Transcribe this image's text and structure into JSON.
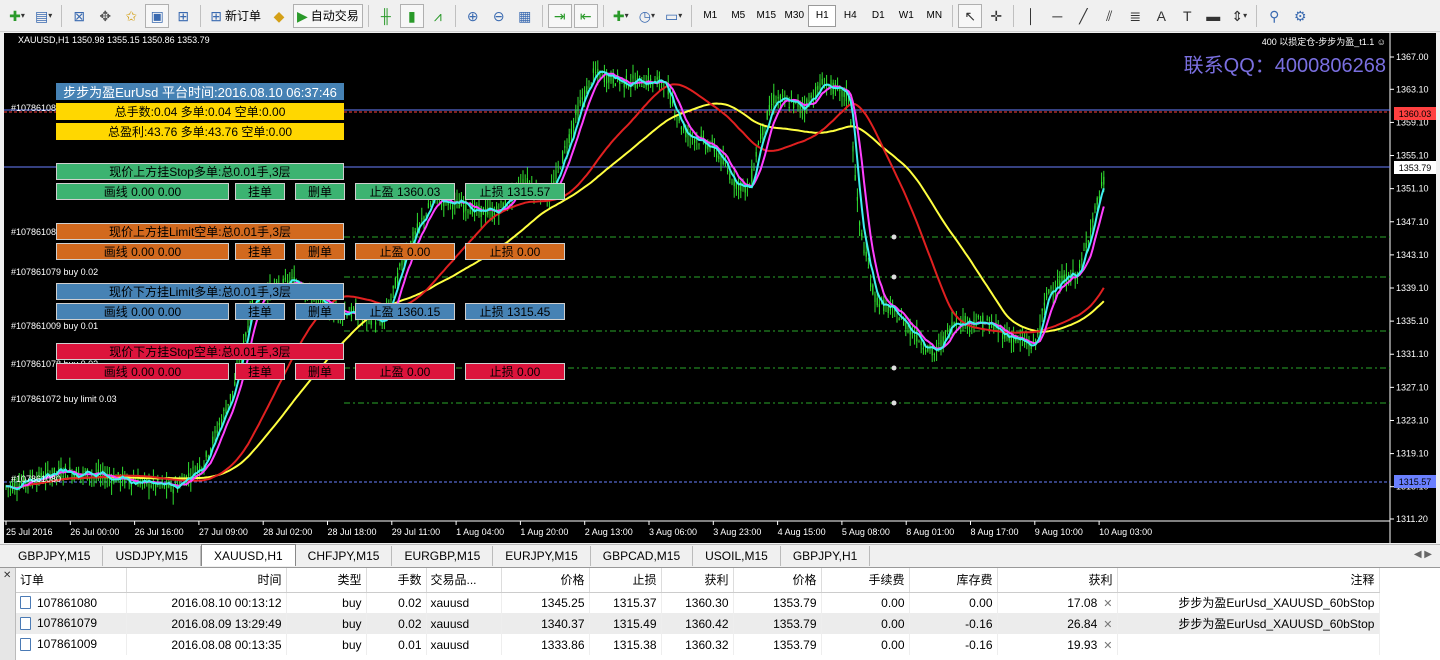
{
  "toolbar": {
    "new_order_label": "新订单",
    "auto_trading_label": "自动交易",
    "timeframes": [
      "M1",
      "M5",
      "M15",
      "M30",
      "H1",
      "H4",
      "D1",
      "W1",
      "MN"
    ],
    "active_timeframe": "H1"
  },
  "chart": {
    "title": "XAUUSD,H1  1350.98 1355.15 1350.86 1353.79",
    "top_right_label": "400 以损定仓-步步为盈_t1.1 ☺",
    "qq_label": "联系QQ：4000806268",
    "price_ticks": [
      "1367.00",
      "1363.10",
      "1359.10",
      "1355.10",
      "1351.10",
      "1347.10",
      "1343.10",
      "1339.10",
      "1335.10",
      "1331.10",
      "1327.10",
      "1323.10",
      "1319.10",
      "1315.10",
      "1311.20"
    ],
    "tags": {
      "tp": "1360.03",
      "current": "1353.79",
      "sl": "1315.57"
    },
    "time_labels": [
      "25 Jul 2016",
      "26 Jul 00:00",
      "26 Jul 16:00",
      "27 Jul 09:00",
      "28 Jul 02:00",
      "28 Jul 18:00",
      "29 Jul 11:00",
      "1 Aug 04:00",
      "1 Aug 20:00",
      "2 Aug 13:00",
      "3 Aug 06:00",
      "3 Aug 23:00",
      "4 Aug 15:00",
      "5 Aug 08:00",
      "8 Aug 01:00",
      "8 Aug 17:00",
      "9 Aug 10:00",
      "10 Aug 03:00"
    ],
    "order_labels": {
      "o1": "#107861080",
      "o2": "#107861080",
      "o3": "#107861079 buy 0.02",
      "o4": "#107861009 buy 0.01",
      "o5": "#107861078 buy 0.02",
      "o6": "#107861072 buy limit 0.03",
      "o7": "#107861080"
    }
  },
  "panel": {
    "header": "步步为盈EurUsd 平台时间:2016.08.10 06:37:46",
    "total_lots": "总手数:0.04 多单:0.04 空单:0.00",
    "total_profit": "总盈利:43.76 多单:43.76 空单:0.00",
    "rows": [
      {
        "title": "现价上方挂Stop多单:总0.01手,3层",
        "draw": "画线 0.00 0.00",
        "place": "挂单",
        "delete": "删单",
        "tp": "止盈 1360.03",
        "sl": "止损 1315.57"
      },
      {
        "title": "现价上方挂Limit空单:总0.01手,3层",
        "draw": "画线 0.00 0.00",
        "place": "挂单",
        "delete": "删单",
        "tp": "止盈 0.00",
        "sl": "止损 0.00"
      },
      {
        "title": "现价下方挂Limit多单:总0.01手,3层",
        "draw": "画线 0.00 0.00",
        "place": "挂单",
        "delete": "删单",
        "tp": "止盈 1360.15",
        "sl": "止损 1315.45"
      },
      {
        "title": "现价下方挂Stop空单:总0.01手,3层",
        "draw": "画线 0.00 0.00",
        "place": "挂单",
        "delete": "删单",
        "tp": "止盈 0.00",
        "sl": "止损 0.00"
      }
    ]
  },
  "symbol_tabs": [
    "GBPJPY,M15",
    "USDJPY,M15",
    "XAUUSD,H1",
    "CHFJPY,M15",
    "EURGBP,M15",
    "EURJPY,M15",
    "GBPCAD,M15",
    "USOIL,M15",
    "GBPJPY,H1"
  ],
  "active_symbol_tab": "XAUUSD,H1",
  "terminal": {
    "headers": [
      "订单",
      "时间",
      "类型",
      "手数",
      "交易品...",
      "价格",
      "止损",
      "获利",
      "价格",
      "手续费",
      "库存费",
      "获利",
      "注释"
    ],
    "rows": [
      [
        "107861080",
        "2016.08.10 00:13:12",
        "buy",
        "0.02",
        "xauusd",
        "1345.25",
        "1315.37",
        "1360.30",
        "1353.79",
        "0.00",
        "0.00",
        "17.08",
        "步步为盈EurUsd_XAUUSD_60bStop"
      ],
      [
        "107861079",
        "2016.08.09 13:29:49",
        "buy",
        "0.02",
        "xauusd",
        "1340.37",
        "1315.49",
        "1360.42",
        "1353.79",
        "0.00",
        "-0.16",
        "26.84",
        "步步为盈EurUsd_XAUUSD_60bStop"
      ],
      [
        "107861009",
        "2016.08.08 00:13:35",
        "buy",
        "0.01",
        "xauusd",
        "1333.86",
        "1315.38",
        "1360.32",
        "1353.79",
        "0.00",
        "-0.16",
        "19.93",
        ""
      ]
    ]
  },
  "colors": {
    "tp_line": "#ff4040",
    "sl_line": "#6a80ff",
    "ma_red": "#e02020",
    "ma_yellow": "#ffff40",
    "ma_cyan": "#40f0f0",
    "ma_magenta": "#ff40ff",
    "candles": "#30e030"
  }
}
